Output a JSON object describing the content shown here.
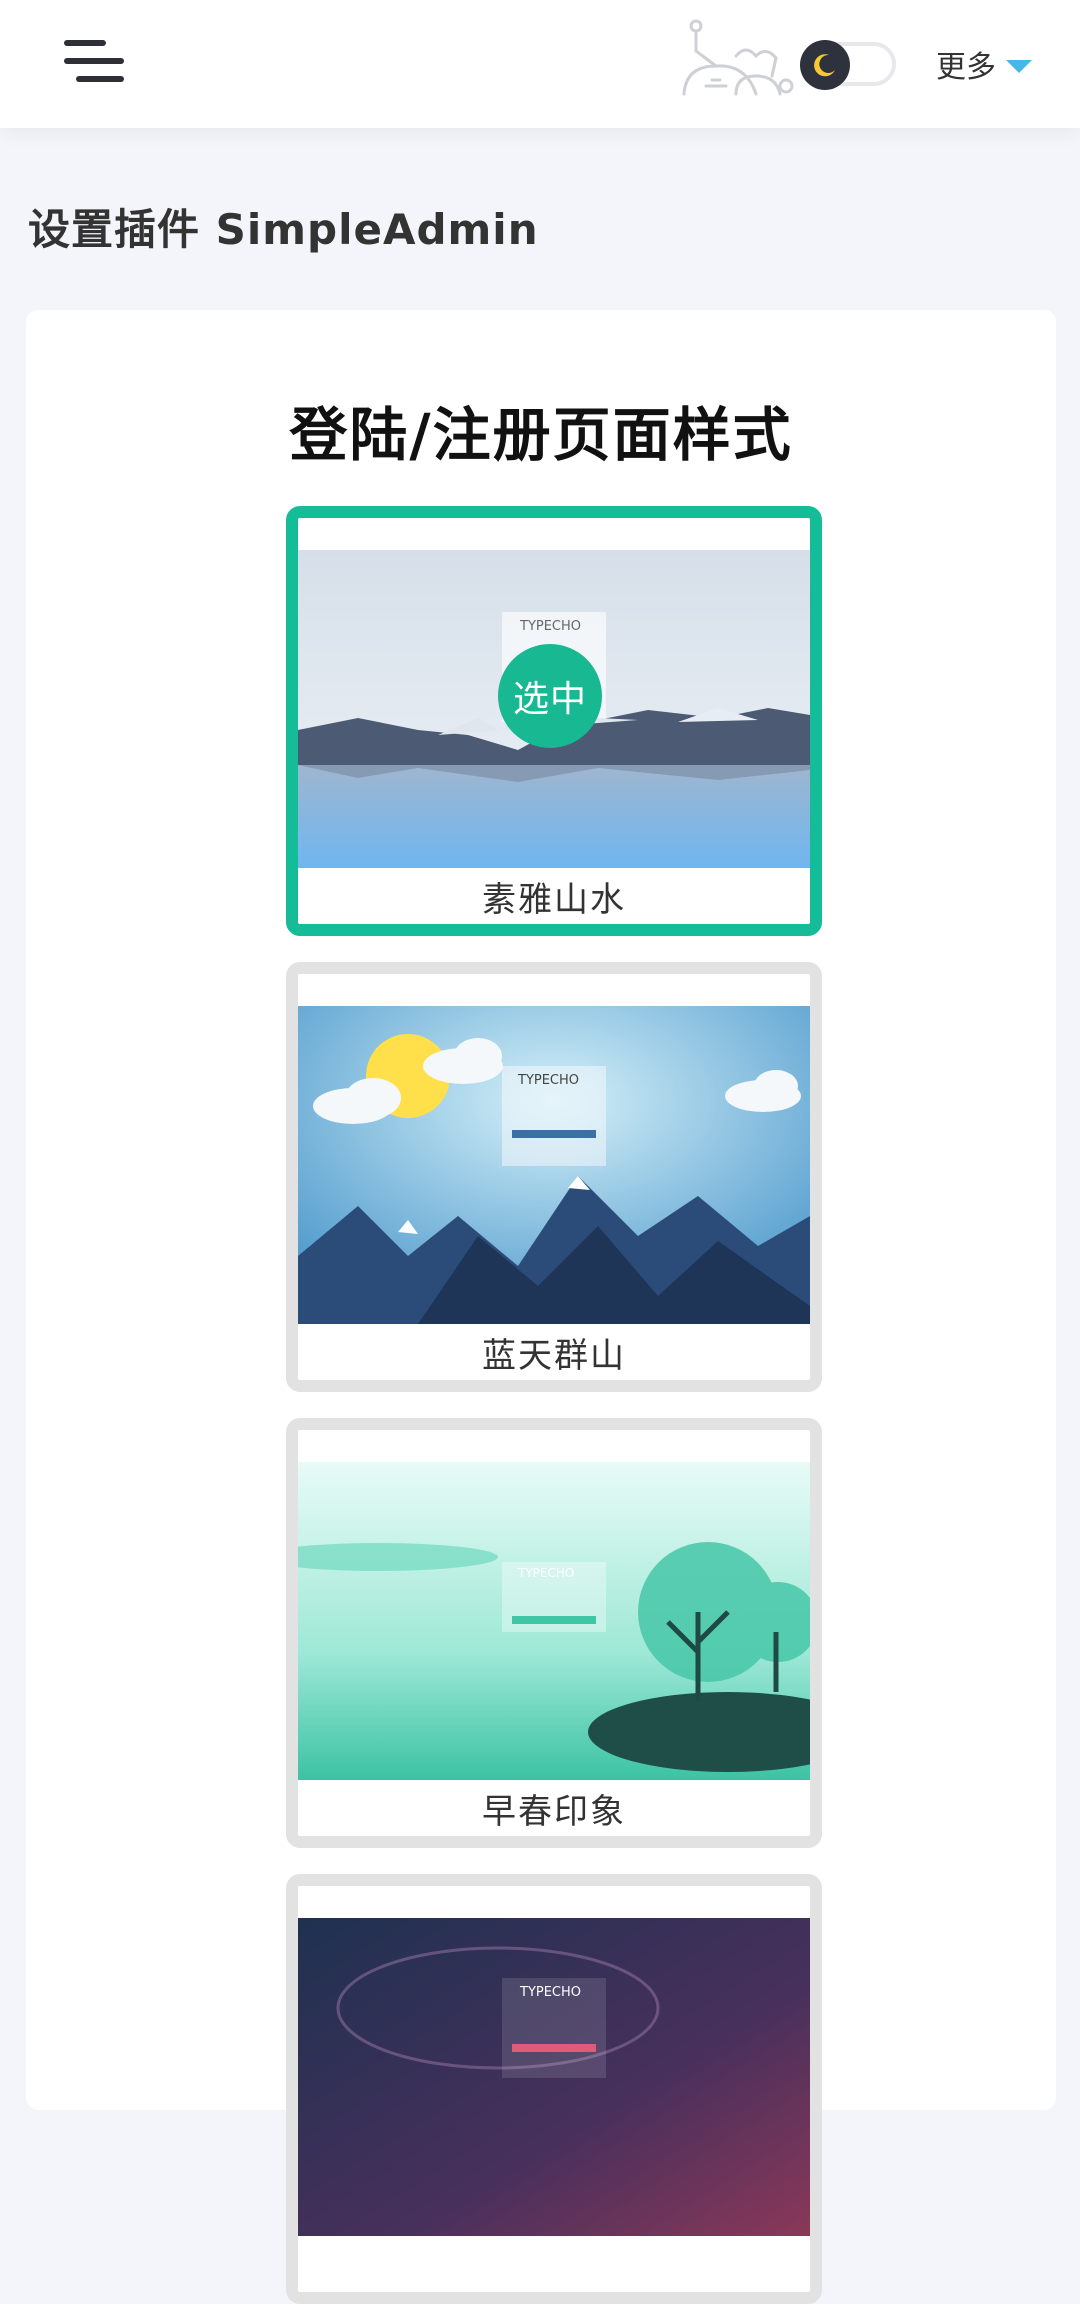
{
  "header": {
    "menu_icon": "hamburger-menu-icon",
    "theme_toggle_icon": "moon-icon",
    "more_label": "更多",
    "more_icon": "caret-down-icon",
    "accent": "#47b6e8"
  },
  "page": {
    "title": "设置插件 SimpleAdmin"
  },
  "section": {
    "title": "登陆/注册页面样式",
    "options": [
      {
        "label": "素雅山水",
        "selected": true,
        "badge": "选中",
        "thumb_brand": "TYPECHO"
      },
      {
        "label": "蓝天群山",
        "selected": false,
        "thumb_brand": "TYPECHO"
      },
      {
        "label": "早春印象",
        "selected": false,
        "thumb_brand": "TYPECHO"
      },
      {
        "label": "",
        "selected": false,
        "thumb_brand": "TYPECHO"
      }
    ],
    "selected_color": "#14bd98",
    "unselected_color": "#e2e2e2"
  }
}
